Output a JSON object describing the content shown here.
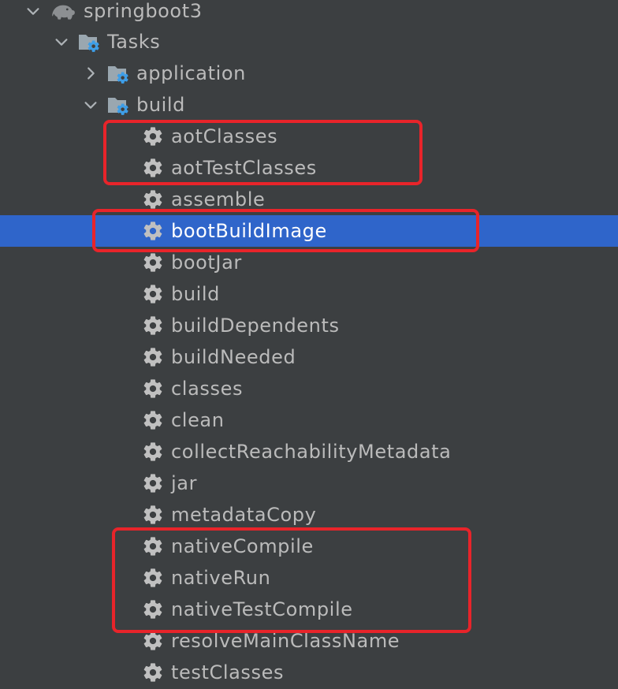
{
  "tree": {
    "root": {
      "label": "springboot3",
      "icon": "gradle-elephant-icon",
      "expanded": true
    },
    "tasks_folder": {
      "label": "Tasks",
      "icon": "task-folder-icon",
      "expanded": true
    },
    "groups": [
      {
        "label": "application",
        "icon": "task-folder-icon",
        "expanded": false
      },
      {
        "label": "build",
        "icon": "task-folder-icon",
        "expanded": true
      }
    ],
    "build_tasks": [
      {
        "label": "aotClasses"
      },
      {
        "label": "aotTestClasses"
      },
      {
        "label": "assemble"
      },
      {
        "label": "bootBuildImage",
        "selected": true
      },
      {
        "label": "bootJar"
      },
      {
        "label": "build"
      },
      {
        "label": "buildDependents"
      },
      {
        "label": "buildNeeded"
      },
      {
        "label": "classes"
      },
      {
        "label": "clean"
      },
      {
        "label": "collectReachabilityMetadata"
      },
      {
        "label": "jar"
      },
      {
        "label": "metadataCopy"
      },
      {
        "label": "nativeCompile"
      },
      {
        "label": "nativeRun"
      },
      {
        "label": "nativeTestCompile"
      },
      {
        "label": "resolveMainClassName"
      },
      {
        "label": "testClasses"
      }
    ]
  },
  "colors": {
    "background": "#3c3f41",
    "text": "#bbbbbb",
    "selection": "#2f65ca",
    "highlight_box": "#e8242a",
    "task_gear": "#c0c0c0",
    "folder_gear": "#3d9ee8"
  }
}
